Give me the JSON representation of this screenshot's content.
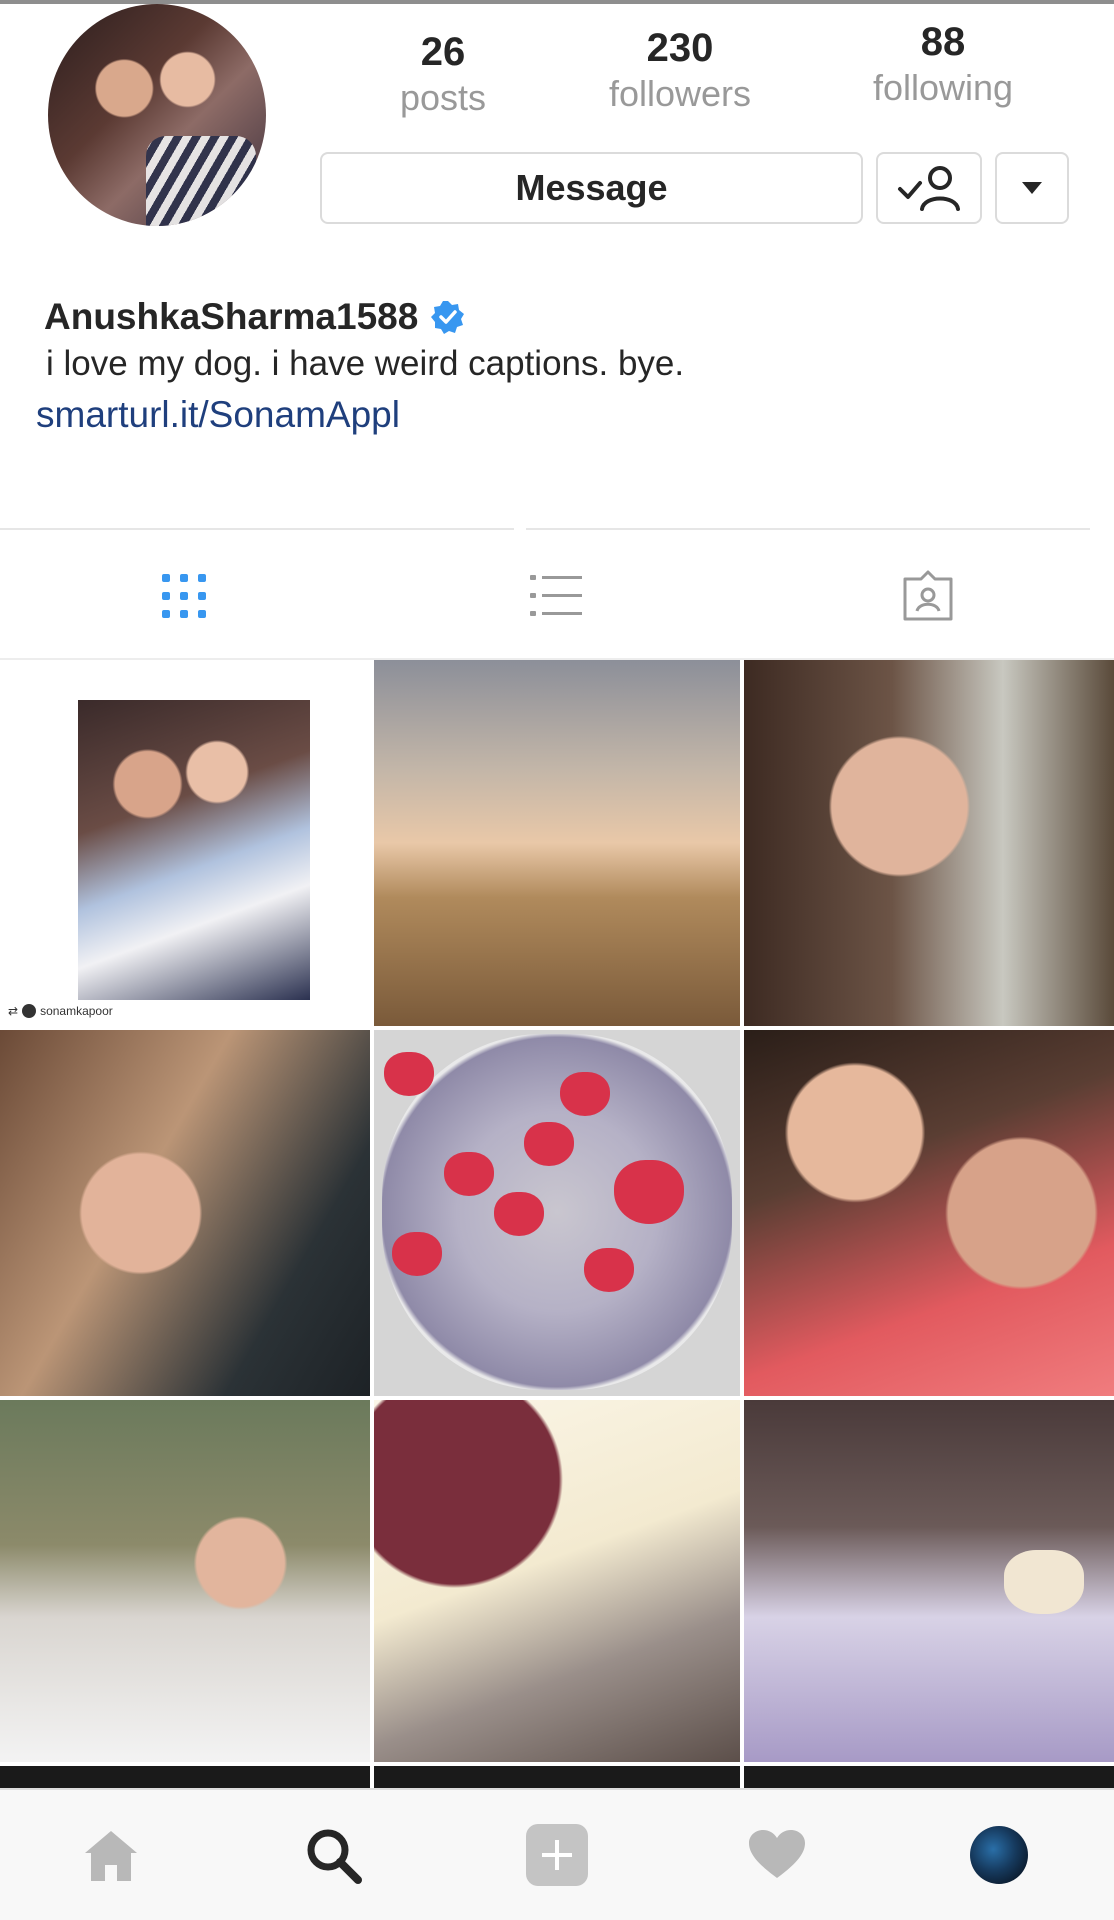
{
  "profile": {
    "username": "AnushkaSharma1588",
    "bio": "i love my dog. i have weird captions. bye.",
    "link": "smarturl.it/SonamAppl",
    "avatar_icon": "profile-photo"
  },
  "stats": {
    "posts_count": "26",
    "posts_label": "posts",
    "followers_count": "230",
    "followers_label": "followers",
    "following_count": "88",
    "following_label": "following"
  },
  "actions": {
    "message_label": "Message",
    "following_icon": "person-check-icon",
    "more_icon": "caret-down-icon"
  },
  "tabs": [
    {
      "name": "grid",
      "icon": "grid-icon",
      "active": true
    },
    {
      "name": "list",
      "icon": "list-icon",
      "active": false
    },
    {
      "name": "tagged",
      "icon": "tagged-icon",
      "active": false
    }
  ],
  "posts": [
    {
      "credit": "sonamkapoor"
    },
    {
      "credit": ""
    },
    {
      "credit": ""
    },
    {
      "credit": ""
    },
    {
      "credit": ""
    },
    {
      "credit": ""
    },
    {
      "credit": ""
    },
    {
      "credit": ""
    },
    {
      "credit": ""
    }
  ],
  "bottom_nav": [
    {
      "name": "home",
      "icon": "home-icon"
    },
    {
      "name": "search",
      "icon": "search-icon"
    },
    {
      "name": "add",
      "icon": "add-icon"
    },
    {
      "name": "activity",
      "icon": "heart-icon"
    },
    {
      "name": "profile",
      "icon": "profile-avatar"
    }
  ],
  "colors": {
    "link": "#1f3f7d",
    "verified": "#3897f0",
    "muted": "#999999",
    "border": "#dbdbdb",
    "active_tab": "#3897f0",
    "inactive_icon": "#999999"
  }
}
